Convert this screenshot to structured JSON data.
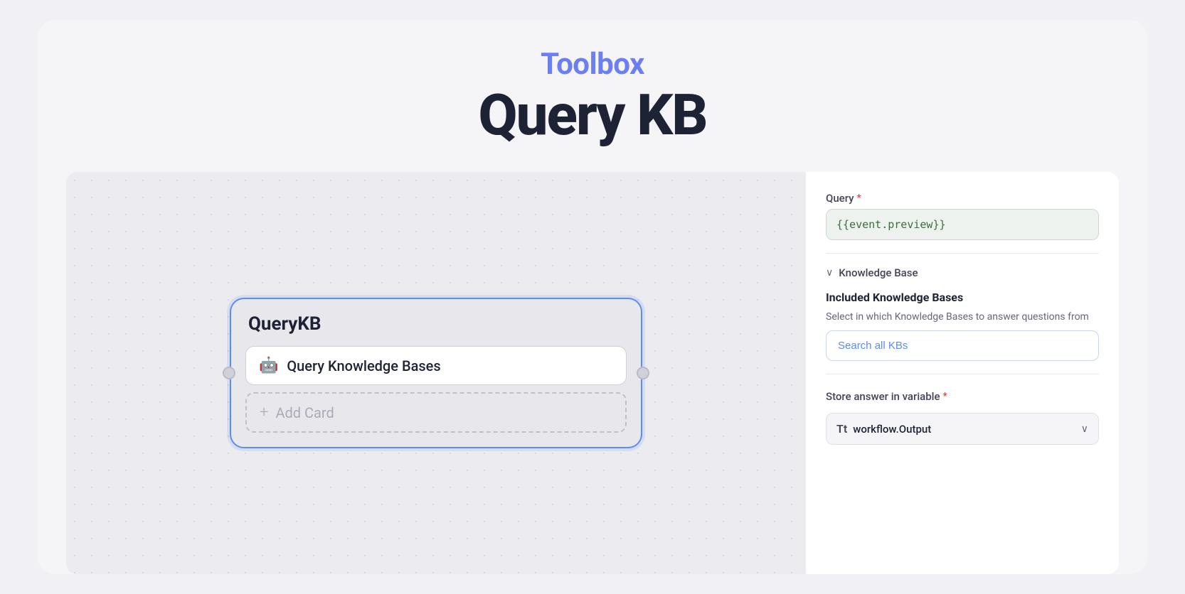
{
  "header": {
    "toolbox_label": "Toolbox",
    "page_title": "Query KB"
  },
  "canvas": {
    "node_title": "QueryKB",
    "node_item": {
      "icon": "🤖",
      "text": "Query Knowledge Bases"
    },
    "add_card_label": "Add Card"
  },
  "right_panel": {
    "query_field": {
      "label": "Query",
      "required": true,
      "value": "{{event.preview}}"
    },
    "knowledge_base_section": {
      "label": "Knowledge Base",
      "included_title": "Included Knowledge Bases",
      "included_desc": "Select in which Knowledge Bases to answer questions from",
      "search_button_label": "Search all KBs"
    },
    "store_variable": {
      "label": "Store answer in variable",
      "required": true,
      "icon": "Tt",
      "value": "workflow.Output"
    }
  }
}
